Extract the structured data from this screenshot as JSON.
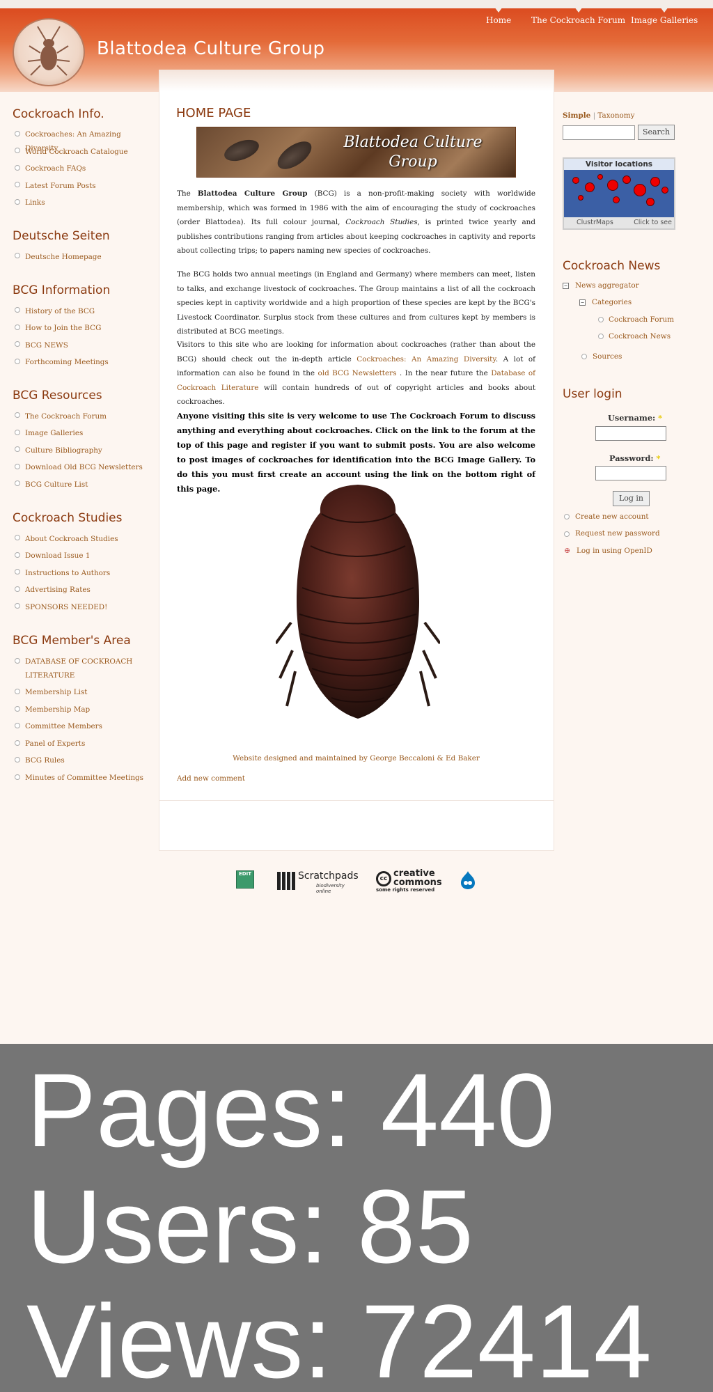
{
  "header": {
    "site_name": "Blattodea Culture Group",
    "nav": [
      "Home",
      "The Cockroach Forum",
      "Image Galleries"
    ]
  },
  "main": {
    "title": "HOME PAGE",
    "banner_text": "Blattodea Culture Group",
    "p1": {
      "a": "The ",
      "b": "Blattodea Culture Group",
      "c": " (BCG) is a non-profit-making society with worldwide membership, which was formed in 1986 with the aim of encouraging the study of cockroaches (order Blattodea). Its full colour journal, ",
      "d": "Cockroach Studies",
      "e": ", is printed twice yearly and publishes contributions ranging from articles about keeping cockroaches in captivity and reports about collecting trips; to papers naming new species of cockroaches."
    },
    "p2": "The BCG holds two annual meetings (in England and Germany) where members can meet, listen to talks, and exchange livestock of cockroaches. The Group maintains a list of all the cockroach species kept in captivity worldwide and a high proportion of these species are kept by the BCG's Livestock Coordinator. Surplus stock from these cultures and from cultures kept by members is distributed at BCG meetings.",
    "p3": {
      "a": "Visitors to this site who are looking for information about cockroaches (rather than about the BCG) should check out the in-depth article ",
      "link1": "Cockroaches: An Amazing Diversity",
      "b": ". A lot of information can also be found in the ",
      "link2": "old BCG Newsletters ",
      "c": ". In the near future the ",
      "link3": "Database of Cockroach Literature",
      "d": " will contain hundreds of out of copyright articles and books about cockroaches."
    },
    "p4": "Anyone visiting this site is very welcome to use The Cockroach Forum to discuss anything and everything about cockroaches. Click on the link to the forum at the top of this page and register if you want to submit posts. You are also welcome to post images of cockroaches for identification into the BCG Image Gallery. To do this you must first create an account using the link on the bottom right of this page.",
    "credit": "Website designed and maintained by George Beccaloni & Ed Baker",
    "add_comment": "Add new comment"
  },
  "left": {
    "blocks": [
      {
        "title": "Cockroach Info.",
        "items": [
          "Cockroaches: An Amazing Diversity",
          "World Cockroach Catalogue",
          "Cockroach FAQs",
          "Latest Forum Posts",
          "Links"
        ]
      },
      {
        "title": "Deutsche Seiten",
        "items": [
          "Deutsche Homepage"
        ]
      },
      {
        "title": "BCG Information",
        "items": [
          "History of the BCG",
          "How to Join the BCG",
          "BCG NEWS",
          "Forthcoming Meetings"
        ]
      },
      {
        "title": "BCG Resources",
        "items": [
          "The Cockroach Forum",
          "Image Galleries",
          "Culture Bibliography",
          "Download Old BCG Newsletters",
          "BCG Culture List"
        ]
      },
      {
        "title": "Cockroach Studies",
        "items": [
          "About Cockroach Studies",
          "Download Issue 1",
          "Instructions to Authors",
          "Advertising Rates",
          "SPONSORS NEEDED!"
        ]
      },
      {
        "title": "BCG Member's Area",
        "items": [
          "DATABASE OF COCKROACH LITERATURE",
          "Membership List",
          "Membership Map",
          "Committee Members",
          "Panel of Experts",
          "BCG Rules",
          "Minutes of Committee Meetings"
        ]
      }
    ]
  },
  "right": {
    "search_tab_simple": "Simple",
    "search_tab_taxonomy": "Taxonomy",
    "search_button": "Search",
    "clustr_title": "Visitor locations",
    "clustr_brand": "ClustrMaps",
    "clustr_hint": "Click to see",
    "news_title": "Cockroach News",
    "news": {
      "aggregator": "News aggregator",
      "categories": "Categories",
      "forum": "Cockroach Forum",
      "news": "Cockroach News",
      "sources": "Sources"
    },
    "login_title": "User login",
    "username_label": "Username:",
    "password_label": "Password:",
    "required_mark": "*",
    "login_button": "Log in",
    "links": [
      "Create new account",
      "Request new password",
      "Log in using OpenID"
    ]
  },
  "footer": {
    "edit_label": "EDIT",
    "scratchpads": "Scratchpads",
    "scratchpads_sub": "biodiversity online",
    "cc_main": "creative commons",
    "cc_sub": "some rights reserved"
  },
  "stats": {
    "pages": "Pages: 440",
    "users": "Users: 85",
    "views": "Views: 72414"
  }
}
